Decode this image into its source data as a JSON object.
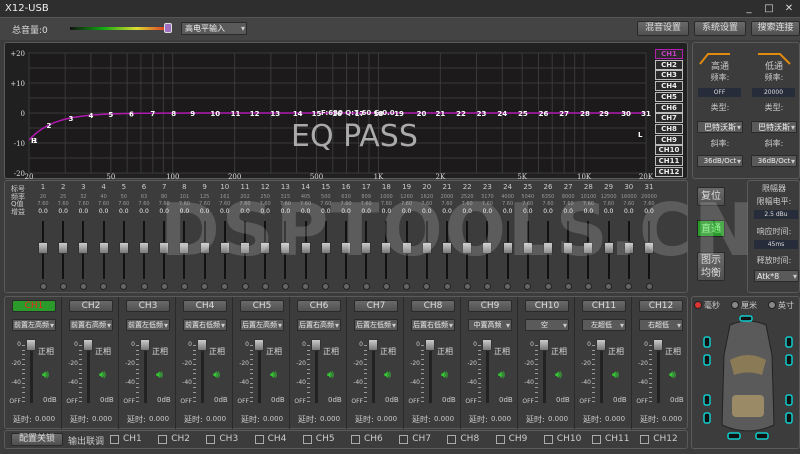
{
  "window": {
    "title": "X12-USB",
    "minimize": "_",
    "maximize": "□",
    "close": "✕"
  },
  "toolbar": {
    "volume_label": "总音量:0",
    "volume_level": 1.0,
    "input_select": "高电平输入",
    "mix_settings": "混音设置",
    "system_settings": "系统设置",
    "search_connect": "搜索连接"
  },
  "graph": {
    "y_ticks": [
      "+20",
      "+10",
      "0",
      "-10",
      "-20"
    ],
    "x_ticks": [
      "20",
      "50",
      "100",
      "200",
      "500",
      "1K",
      "2K",
      "5K",
      "10K",
      "20K"
    ],
    "info": "F:630 Q:7.60 G:0.0",
    "mode_text": "EQ PASS",
    "hpf_marker": "H",
    "lpf_marker": "L",
    "curve_color": "#b01ab0"
  },
  "channel_selector": {
    "selected": "CH1",
    "items": [
      "CH1",
      "CH2",
      "CH3",
      "CH4",
      "CH5",
      "CH6",
      "CH7",
      "CH8",
      "CH9",
      "CH10",
      "CH11",
      "CH12"
    ]
  },
  "crossover": {
    "hp": {
      "title": "高通",
      "freq_label": "频率:",
      "freq": "OFF",
      "type_label": "类型:",
      "type": "巴特沃斯",
      "slope_label": "斜率:",
      "slope": "36dB/Oct"
    },
    "lp": {
      "title": "低通",
      "freq_label": "频率:",
      "freq": "20000",
      "type_label": "类型:",
      "type": "巴特沃斯",
      "slope_label": "斜率:",
      "slope": "36dB/Oct"
    }
  },
  "eq": {
    "row_labels": [
      "标号",
      "频率",
      "Q值",
      "增益"
    ],
    "bands": [
      {
        "n": "1",
        "f": "20",
        "q": "7.60",
        "g": "0.0"
      },
      {
        "n": "2",
        "f": "25",
        "q": "7.60",
        "g": "0.0"
      },
      {
        "n": "3",
        "f": "32",
        "q": "7.60",
        "g": "0.0"
      },
      {
        "n": "4",
        "f": "40",
        "q": "7.60",
        "g": "0.0"
      },
      {
        "n": "5",
        "f": "50",
        "q": "7.60",
        "g": "0.0"
      },
      {
        "n": "6",
        "f": "63",
        "q": "7.60",
        "g": "0.0"
      },
      {
        "n": "7",
        "f": "80",
        "q": "7.60",
        "g": "0.0"
      },
      {
        "n": "8",
        "f": "101",
        "q": "7.60",
        "g": "0.0"
      },
      {
        "n": "9",
        "f": "125",
        "q": "7.60",
        "g": "0.0"
      },
      {
        "n": "10",
        "f": "161",
        "q": "7.60",
        "g": "0.0"
      },
      {
        "n": "11",
        "f": "202",
        "q": "7.60",
        "g": "0.0"
      },
      {
        "n": "12",
        "f": "250",
        "q": "7.60",
        "g": "0.0"
      },
      {
        "n": "13",
        "f": "315",
        "q": "7.60",
        "g": "0.0"
      },
      {
        "n": "14",
        "f": "405",
        "q": "7.60",
        "g": "0.0"
      },
      {
        "n": "15",
        "f": "500",
        "q": "7.60",
        "g": "0.0"
      },
      {
        "n": "16",
        "f": "630",
        "q": "7.60",
        "g": "0.0"
      },
      {
        "n": "17",
        "f": "809",
        "q": "7.60",
        "g": "0.0"
      },
      {
        "n": "18",
        "f": "1000",
        "q": "7.60",
        "g": "0.0"
      },
      {
        "n": "19",
        "f": "1260",
        "q": "7.60",
        "g": "0.0"
      },
      {
        "n": "20",
        "f": "1620",
        "q": "7.60",
        "g": "0.0"
      },
      {
        "n": "21",
        "f": "2000",
        "q": "7.60",
        "g": "0.0"
      },
      {
        "n": "22",
        "f": "2520",
        "q": "7.60",
        "g": "0.0"
      },
      {
        "n": "23",
        "f": "3170",
        "q": "7.60",
        "g": "0.0"
      },
      {
        "n": "24",
        "f": "4000",
        "q": "7.60",
        "g": "0.0"
      },
      {
        "n": "25",
        "f": "5040",
        "q": "7.60",
        "g": "0.0"
      },
      {
        "n": "26",
        "f": "6350",
        "q": "7.60",
        "g": "0.0"
      },
      {
        "n": "27",
        "f": "8000",
        "q": "7.60",
        "g": "0.0"
      },
      {
        "n": "28",
        "f": "10100",
        "q": "7.60",
        "g": "0.0"
      },
      {
        "n": "29",
        "f": "12500",
        "q": "7.60",
        "g": "0.0"
      },
      {
        "n": "30",
        "f": "16000",
        "q": "7.60",
        "g": "0.0"
      },
      {
        "n": "31",
        "f": "20000",
        "q": "7.60",
        "g": "0.0"
      }
    ],
    "reset": "复位",
    "bypass": "直通",
    "graphic_eq": "图示\n均衡"
  },
  "limiter": {
    "title": "限幅器",
    "level_label": "限幅电平:",
    "level": "2.5 dBu",
    "attack_label": "响应时间:",
    "attack": "45ms",
    "release_label": "释放时间:",
    "release": "Atk*8"
  },
  "watermark": "DSPTOOLS.CN",
  "outputs": [
    {
      "ch": "CH1",
      "name": "前置左高频",
      "phase": "正相",
      "gain": "0dB",
      "delay_label": "延时:",
      "delay": "0.000",
      "active": true
    },
    {
      "ch": "CH2",
      "name": "前置右高频",
      "phase": "正相",
      "gain": "0dB",
      "delay_label": "延时:",
      "delay": "0.000"
    },
    {
      "ch": "CH3",
      "name": "前置左低频",
      "phase": "正相",
      "gain": "0dB",
      "delay_label": "延时:",
      "delay": "0.000"
    },
    {
      "ch": "CH4",
      "name": "前置右低频",
      "phase": "正相",
      "gain": "0dB",
      "delay_label": "延时:",
      "delay": "0.000"
    },
    {
      "ch": "CH5",
      "name": "后置左高频",
      "phase": "正相",
      "gain": "0dB",
      "delay_label": "延时:",
      "delay": "0.000"
    },
    {
      "ch": "CH6",
      "name": "后置右高频",
      "phase": "正相",
      "gain": "0dB",
      "delay_label": "延时:",
      "delay": "0.000"
    },
    {
      "ch": "CH7",
      "name": "后置左低频",
      "phase": "正相",
      "gain": "0dB",
      "delay_label": "延时:",
      "delay": "0.000"
    },
    {
      "ch": "CH8",
      "name": "后置右低频",
      "phase": "正相",
      "gain": "0dB",
      "delay_label": "延时:",
      "delay": "0.000"
    },
    {
      "ch": "CH9",
      "name": "中置高频",
      "phase": "正相",
      "gain": "0dB",
      "delay_label": "延时:",
      "delay": "0.000"
    },
    {
      "ch": "CH10",
      "name": "空",
      "phase": "正相",
      "gain": "0dB",
      "delay_label": "延时:",
      "delay": "0.000"
    },
    {
      "ch": "CH11",
      "name": "左超低",
      "phase": "正相",
      "gain": "0dB",
      "delay_label": "延时:",
      "delay": "0.000"
    },
    {
      "ch": "CH12",
      "name": "右超低",
      "phase": "正相",
      "gain": "0dB",
      "delay_label": "延时:",
      "delay": "0.000"
    }
  ],
  "fader_scale": [
    "0",
    "-20",
    "-40",
    "OFF"
  ],
  "bottom": {
    "lock": "配置关锁",
    "link_label": "输出联调",
    "link_channels": [
      "CH1",
      "CH2",
      "CH3",
      "CH4",
      "CH5",
      "CH6",
      "CH7",
      "CH8",
      "CH9",
      "CH10",
      "CH11",
      "CH12"
    ]
  },
  "units": {
    "options": [
      "毫秒",
      "厘米",
      "英寸"
    ],
    "selected": "毫秒"
  }
}
